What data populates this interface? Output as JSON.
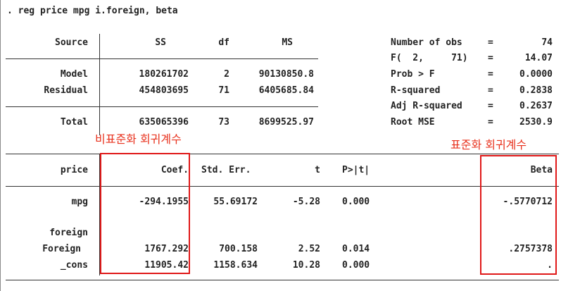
{
  "command": ". reg price mpg i.foreign, beta",
  "anova": {
    "headers": {
      "source": "Source",
      "ss": "SS",
      "df": "df",
      "ms": "MS"
    },
    "rows": [
      {
        "source": "Model",
        "ss": "180261702",
        "df": "2",
        "ms": "90130850.8"
      },
      {
        "source": "Residual",
        "ss": "454803695",
        "df": "71",
        "ms": "6405685.84"
      }
    ],
    "total": {
      "source": "Total",
      "ss": "635065396",
      "df": "73",
      "ms": "8699525.97"
    }
  },
  "stats": [
    {
      "label": "Number of obs",
      "eq": "=",
      "value": "74"
    },
    {
      "label": "F(  2,     71)",
      "eq": "=",
      "value": "14.07"
    },
    {
      "label": "Prob > F",
      "eq": "=",
      "value": "0.0000"
    },
    {
      "label": "R-squared",
      "eq": "=",
      "value": "0.2838"
    },
    {
      "label": "Adj R-squared",
      "eq": "=",
      "value": "0.2637"
    },
    {
      "label": "Root MSE",
      "eq": "=",
      "value": "2530.9"
    }
  ],
  "annotations": {
    "unstd_coef": "비표준화 회귀계수",
    "std_coef": "표준화 회귀계수"
  },
  "coef": {
    "headers": {
      "var": "price",
      "coef": "Coef.",
      "se": "Std. Err.",
      "t": "t",
      "p": "P>|t|",
      "beta": "Beta"
    },
    "rows": [
      {
        "var": "mpg",
        "coef": "-294.1955",
        "se": "55.69172",
        "t": "-5.28",
        "p": "0.000",
        "beta": "-.5770712"
      },
      {
        "var": "foreign",
        "coef": "",
        "se": "",
        "t": "",
        "p": "",
        "beta": ""
      },
      {
        "var": "Foreign",
        "coef": "1767.292",
        "se": "700.158",
        "t": "2.52",
        "p": "0.014",
        "beta": ".2757378"
      },
      {
        "var": "_cons",
        "coef": "11905.42",
        "se": "1158.634",
        "t": "10.28",
        "p": "0.000",
        "beta": "."
      }
    ]
  }
}
